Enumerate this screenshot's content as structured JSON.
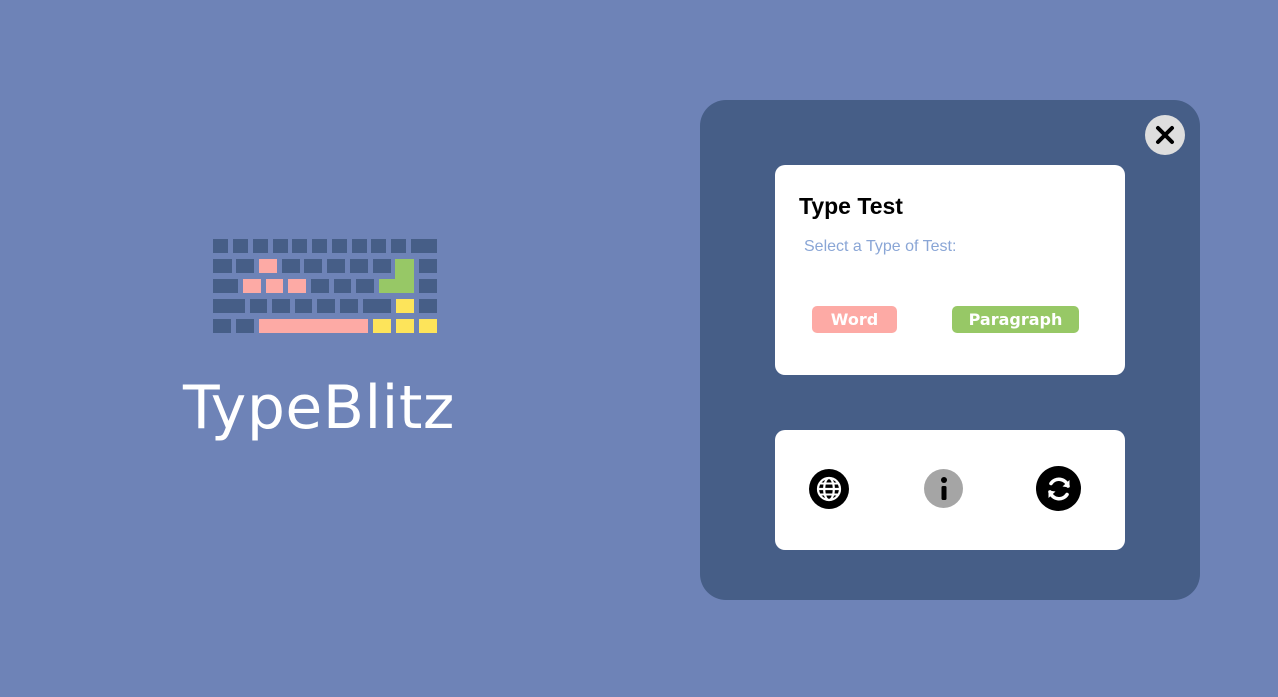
{
  "app": {
    "name": "TypeBlitz"
  },
  "type_test": {
    "title": "Type Test",
    "subtitle": "Select a Type of Test:",
    "options": {
      "word_label": "Word",
      "paragraph_label": "Paragraph"
    }
  },
  "tools": {
    "language_icon": "globe-icon",
    "info_icon": "info-icon",
    "reset_icon": "refresh-icon"
  },
  "close_icon": "close-icon",
  "colors": {
    "background": "#6e83b7",
    "panel": "#465e87",
    "key_default": "#465e87",
    "key_pink": "#fdaaa5",
    "key_green": "#97c866",
    "key_yellow": "#fde45a",
    "subtitle_text": "#8aa6d6",
    "word_button": "#fdaaa5",
    "paragraph_button": "#97c866"
  }
}
